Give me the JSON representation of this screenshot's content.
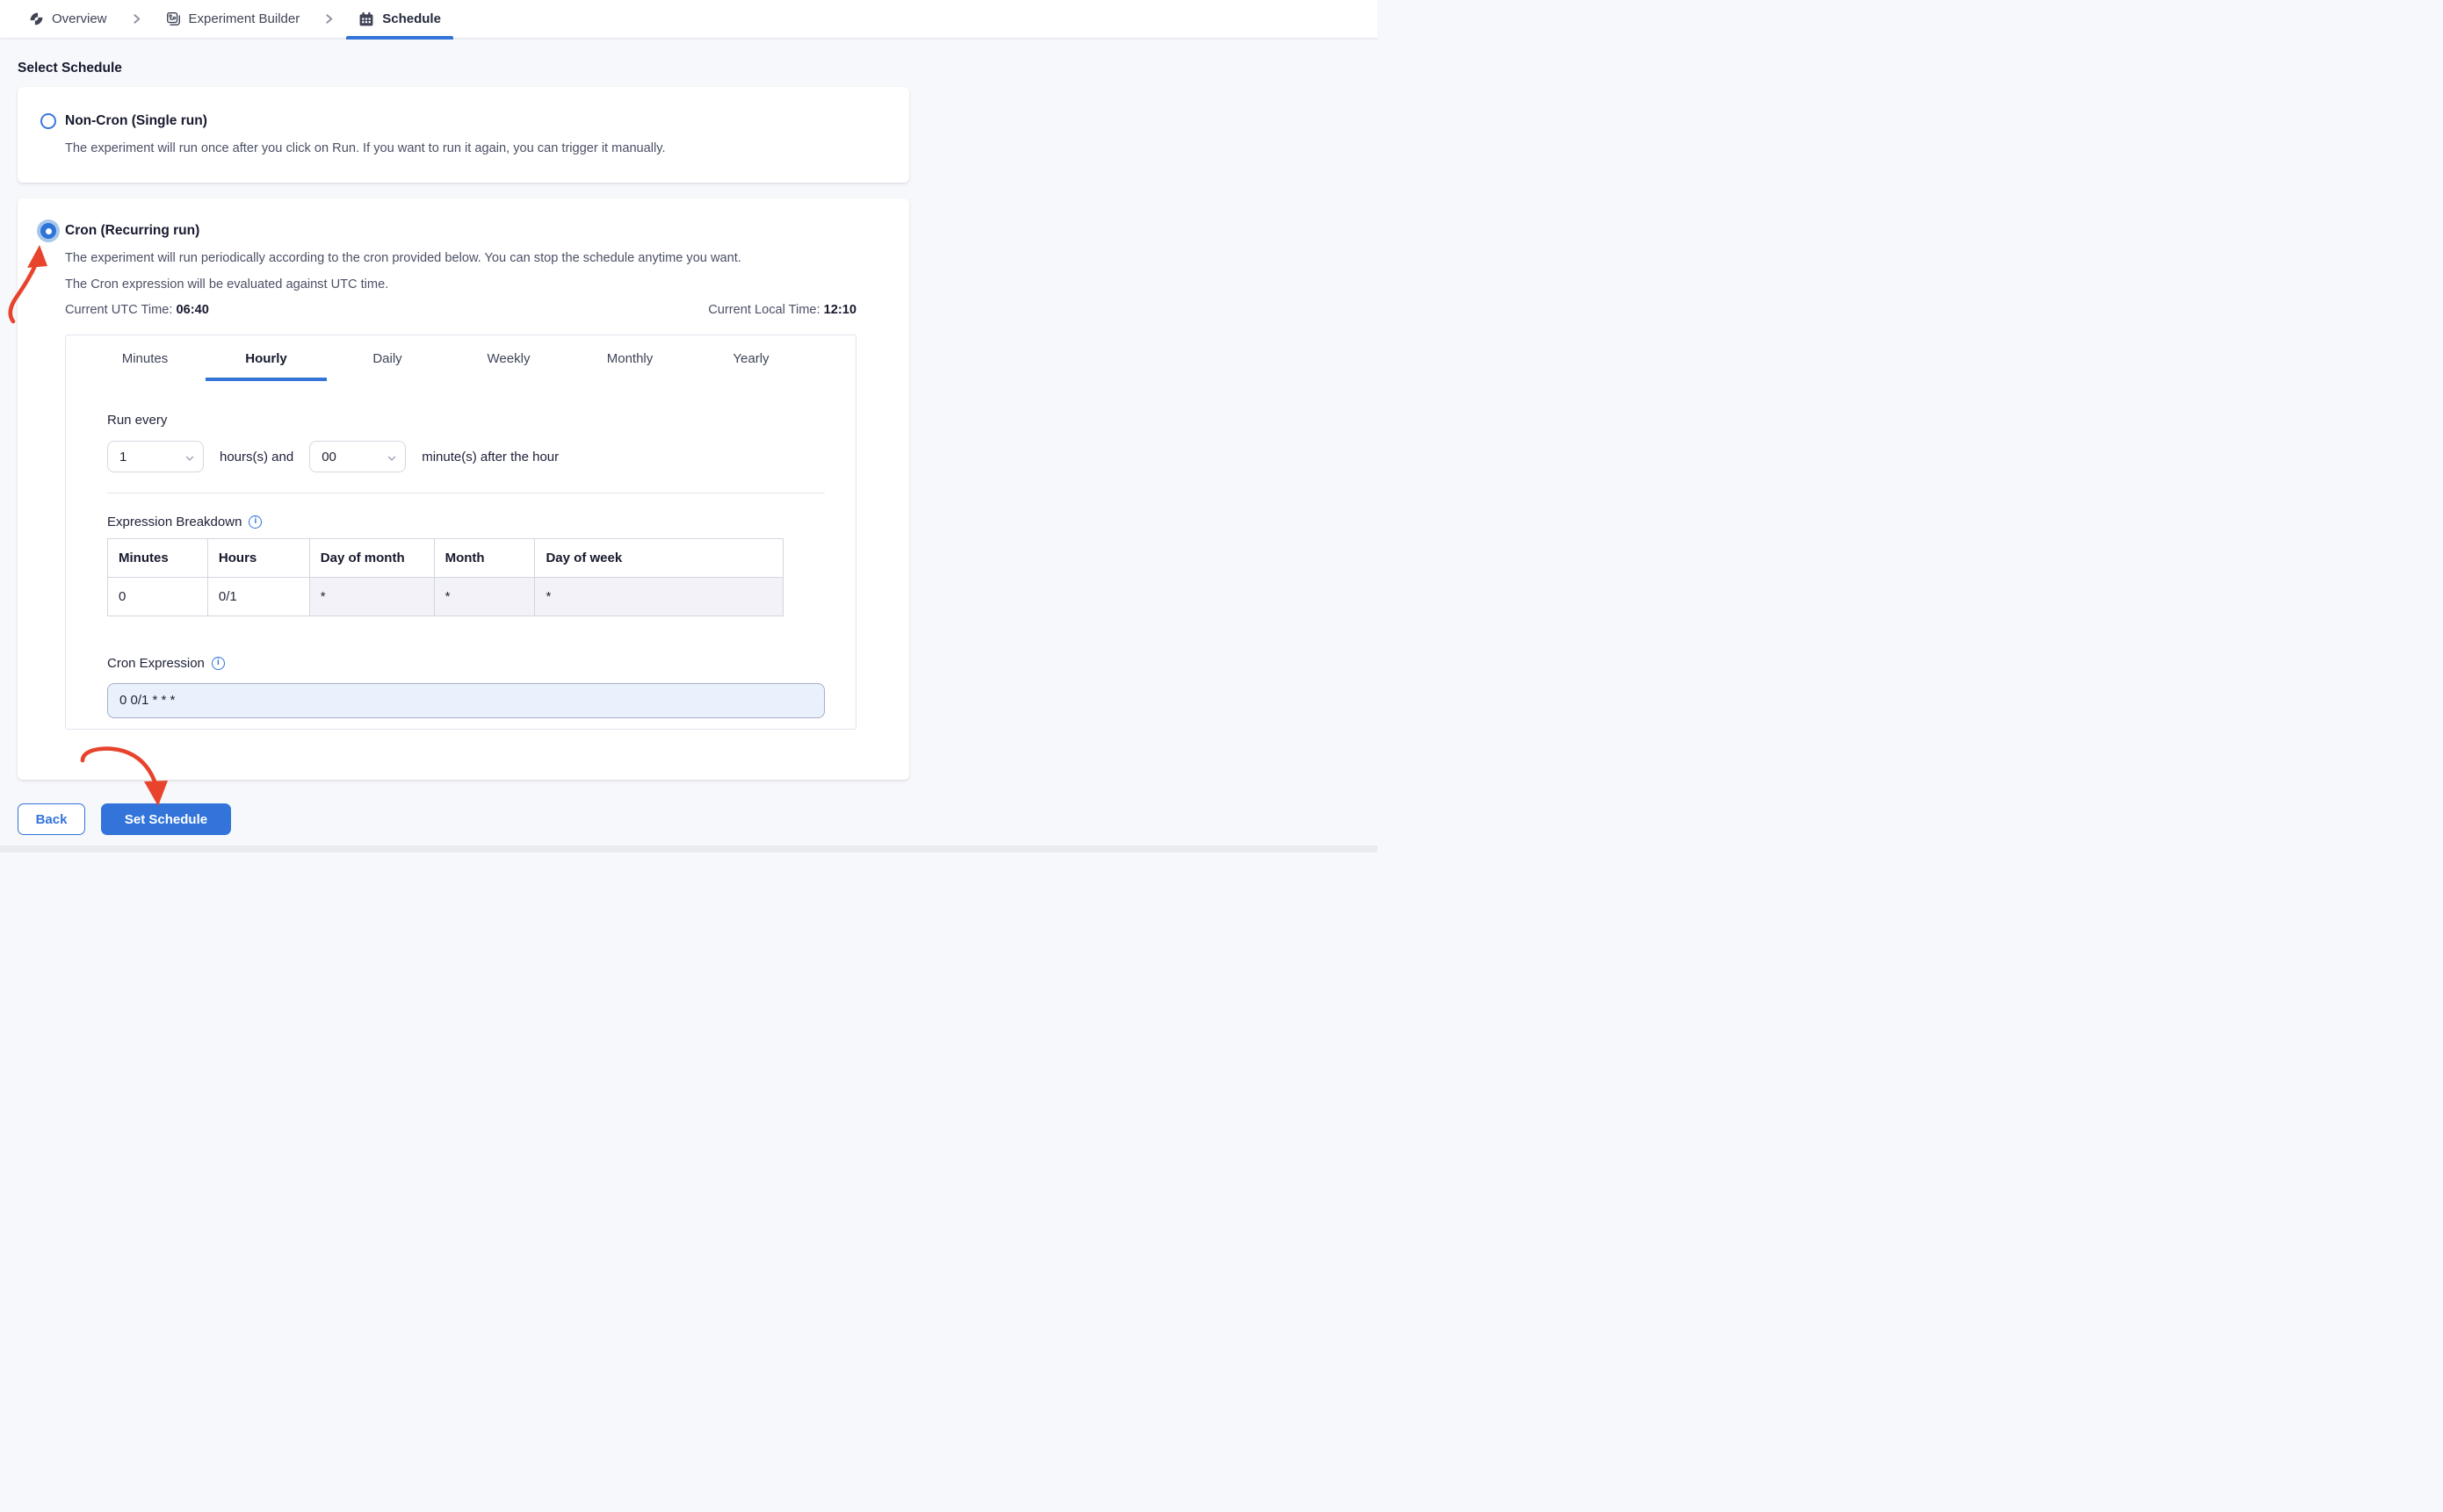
{
  "breadcrumb": {
    "overview": "Overview",
    "experiment_builder": "Experiment Builder",
    "schedule": "Schedule"
  },
  "page": {
    "heading": "Select Schedule"
  },
  "non_cron": {
    "title": "Non-Cron (Single run)",
    "description": "The experiment will run once after you click on Run. If you want to run it again, you can trigger it manually."
  },
  "cron": {
    "title": "Cron (Recurring run)",
    "description_1": "The experiment will run periodically according to the cron provided below. You can stop the schedule anytime you want.",
    "description_2": "The Cron expression will be evaluated against UTC time.",
    "utc_time_label": "Current UTC Time:",
    "utc_time_value": "06:40",
    "local_time_label": "Current Local Time:",
    "local_time_value": "12:10"
  },
  "scheduler": {
    "tabs": [
      "Minutes",
      "Hourly",
      "Daily",
      "Weekly",
      "Monthly",
      "Yearly"
    ],
    "active_tab": "Hourly",
    "run_every_label": "Run every",
    "hours_select_value": "1",
    "hours_text": "hours(s) and",
    "minutes_select_value": "00",
    "minutes_text": "minute(s) after the hour",
    "breakdown_label": "Expression Breakdown",
    "table": {
      "columns": [
        "Minutes",
        "Hours",
        "Day of month",
        "Month",
        "Day of week"
      ],
      "row": [
        "0",
        "0/1",
        "*",
        "*",
        "*"
      ]
    },
    "cron_expression_label": "Cron Expression",
    "cron_expression_value": "0 0/1 * * *"
  },
  "actions": {
    "back": "Back",
    "set_schedule": "Set Schedule"
  },
  "colors": {
    "accent": "#3274d9",
    "annotation_red": "#e8432c"
  }
}
